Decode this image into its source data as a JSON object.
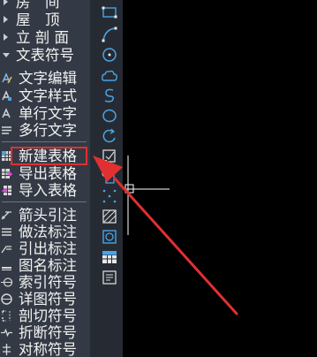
{
  "menu": {
    "sections": [
      {
        "label": "房　间",
        "state": "collapsed"
      },
      {
        "label": "屋　顶",
        "state": "collapsed"
      },
      {
        "label": "立 剖 面",
        "state": "collapsed"
      },
      {
        "label": "文表符号",
        "state": "expanded"
      }
    ],
    "text_tools": [
      "文字编辑",
      "文字样式",
      "单行文字",
      "多行文字"
    ],
    "table_tools": [
      "新建表格",
      "导出表格",
      "导入表格"
    ],
    "annotation_tools": [
      "箭头引注",
      "做法标注",
      "引出标注",
      "图名标注",
      "索引符号",
      "详图符号",
      "剖切符号",
      "折断符号",
      "对称符号"
    ],
    "highlighted_item": "新建表格",
    "highlight_color": "#e03030"
  },
  "toolbar": {
    "icons": [
      "rectangle-icon",
      "arc-icon",
      "circle-center-icon",
      "cloud-icon",
      "spline-icon",
      "ellipse-icon",
      "rotate-arc-icon",
      "insert-block-icon",
      "make-block-icon",
      "point-icon",
      "hatch-icon",
      "region-icon",
      "table-icon",
      "attribute-icon"
    ]
  },
  "colors": {
    "menu_bg": "#343a45",
    "toolbar_bg": "#262b33",
    "toolbar_icon": "#4aa3e6",
    "canvas_bg": "#000000",
    "crosshair": "#ffffff",
    "annotation_arrow": "#e03030"
  }
}
